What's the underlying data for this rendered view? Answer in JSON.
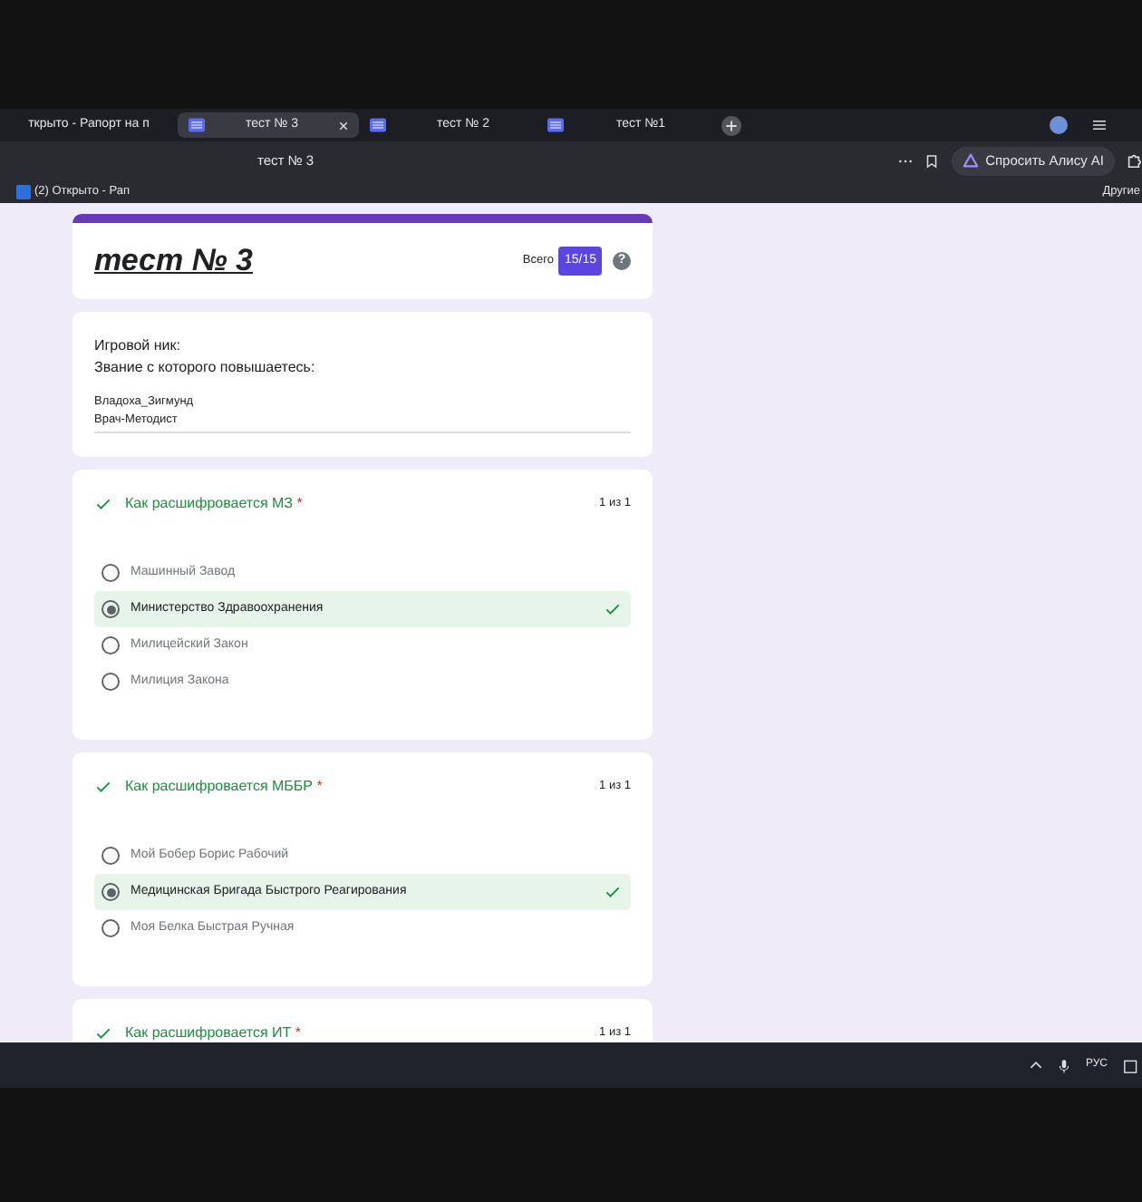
{
  "browser": {
    "tabs": [
      {
        "label": "ткрыто - Рапорт на п",
        "selected": false,
        "kind": "cut"
      },
      {
        "label": "тест № 3",
        "selected": true,
        "kind": "form"
      },
      {
        "label": "тест № 2",
        "selected": false,
        "kind": "form"
      },
      {
        "label": "тест №1",
        "selected": false,
        "kind": "form"
      }
    ],
    "address": "тест № 3",
    "alice_button": "Спросить Алису AI",
    "bookmarks": [
      {
        "label": "(2) Открыто - Рап"
      }
    ],
    "other_bookmarks": "Другие"
  },
  "form": {
    "title": "тест № 3",
    "total_label": "Всего",
    "score": "15/15",
    "help_symbol": "?",
    "fields": [
      {
        "label": "Игровой ник:"
      },
      {
        "label": "Звание с которого повышаетесь:"
      }
    ],
    "answers": [
      "Владоха_Зигмунд",
      "Врач-Методист"
    ],
    "questions": [
      {
        "title": "Как расшифровается МЗ",
        "required_mark": "*",
        "correct": true,
        "points": "1 из 1",
        "options": [
          {
            "label": "Машинный Завод",
            "selected": false
          },
          {
            "label": "Министерство Здравоохранения",
            "selected": true
          },
          {
            "label": "Милицейский Закон",
            "selected": false
          },
          {
            "label": "Милиция Закона",
            "selected": false
          }
        ]
      },
      {
        "title": "Как расшифровается МББР",
        "required_mark": "*",
        "correct": true,
        "points": "1 из 1",
        "options": [
          {
            "label": "Мой Бобер Борис Рабочий",
            "selected": false
          },
          {
            "label": "Медицинская Бригада Быстрого Реагирования",
            "selected": true
          },
          {
            "label": "Моя Белка Быстрая Ручная",
            "selected": false
          }
        ]
      },
      {
        "title": "Как расшифровается ИТ",
        "required_mark": "*",
        "correct": true,
        "points": "1 из 1"
      }
    ]
  },
  "taskbar": {
    "language": "РУС"
  }
}
